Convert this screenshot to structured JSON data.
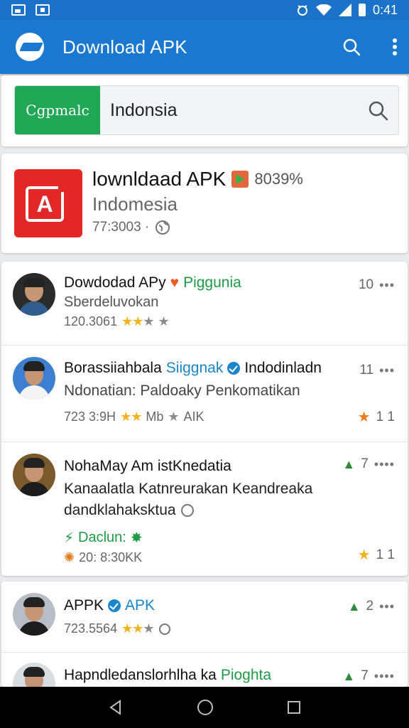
{
  "status_bar": {
    "time": "0:41"
  },
  "app_bar": {
    "title": "Download APK"
  },
  "search": {
    "chip_label": "Cgpmalc",
    "query": "Indonsia"
  },
  "featured": {
    "title": "lownldaad APK",
    "percent": "8039%",
    "subtitle": "Indomesia",
    "meta": "77:3003 ·"
  },
  "list": [
    {
      "title": "Dowdodad APy",
      "tag": "Piggunia",
      "line1": "Sberdeluvokan",
      "meta": "120.3061",
      "right": "10",
      "colors": {
        "avatar_bg": "#2a2a2a",
        "body": "#2f5d8e"
      }
    },
    {
      "title": "Borassiiahbala",
      "tag": "Siiggnak",
      "tag2": "Indodinladn",
      "line1": "Ndonatian: Paldoaky Penkomatikan",
      "meta": "723 3:9H",
      "meta_tail": "Mb",
      "meta_extra": "AIK",
      "right": "11",
      "right_bottom": "1 1",
      "colors": {
        "avatar_bg": "#3d7fd1",
        "body": "#f4f4f4"
      }
    },
    {
      "title": "NohaMay Am istKnedatia",
      "line1": "Kanaalatla Katnreurakan Keandreaka",
      "line2": "dandklahaksktua",
      "green_label": "Daclun:",
      "meta": "20: 8:30KK",
      "right_top": "7",
      "right_bottom": "1 1",
      "colors": {
        "avatar_bg": "#7a5a2a",
        "body": "#1c1c1c"
      }
    },
    {
      "title": "APPK",
      "tag": "APK",
      "meta": "723.5564",
      "right_top": "2",
      "colors": {
        "avatar_bg": "#b7bec6",
        "body": "#1c1c1c"
      }
    },
    {
      "title": "Hapndledanslorhlha ka",
      "tag": "Pioghta",
      "right_top": "7",
      "colors": {
        "avatar_bg": "#d8dde2",
        "body": "#1c1c1c"
      }
    }
  ]
}
